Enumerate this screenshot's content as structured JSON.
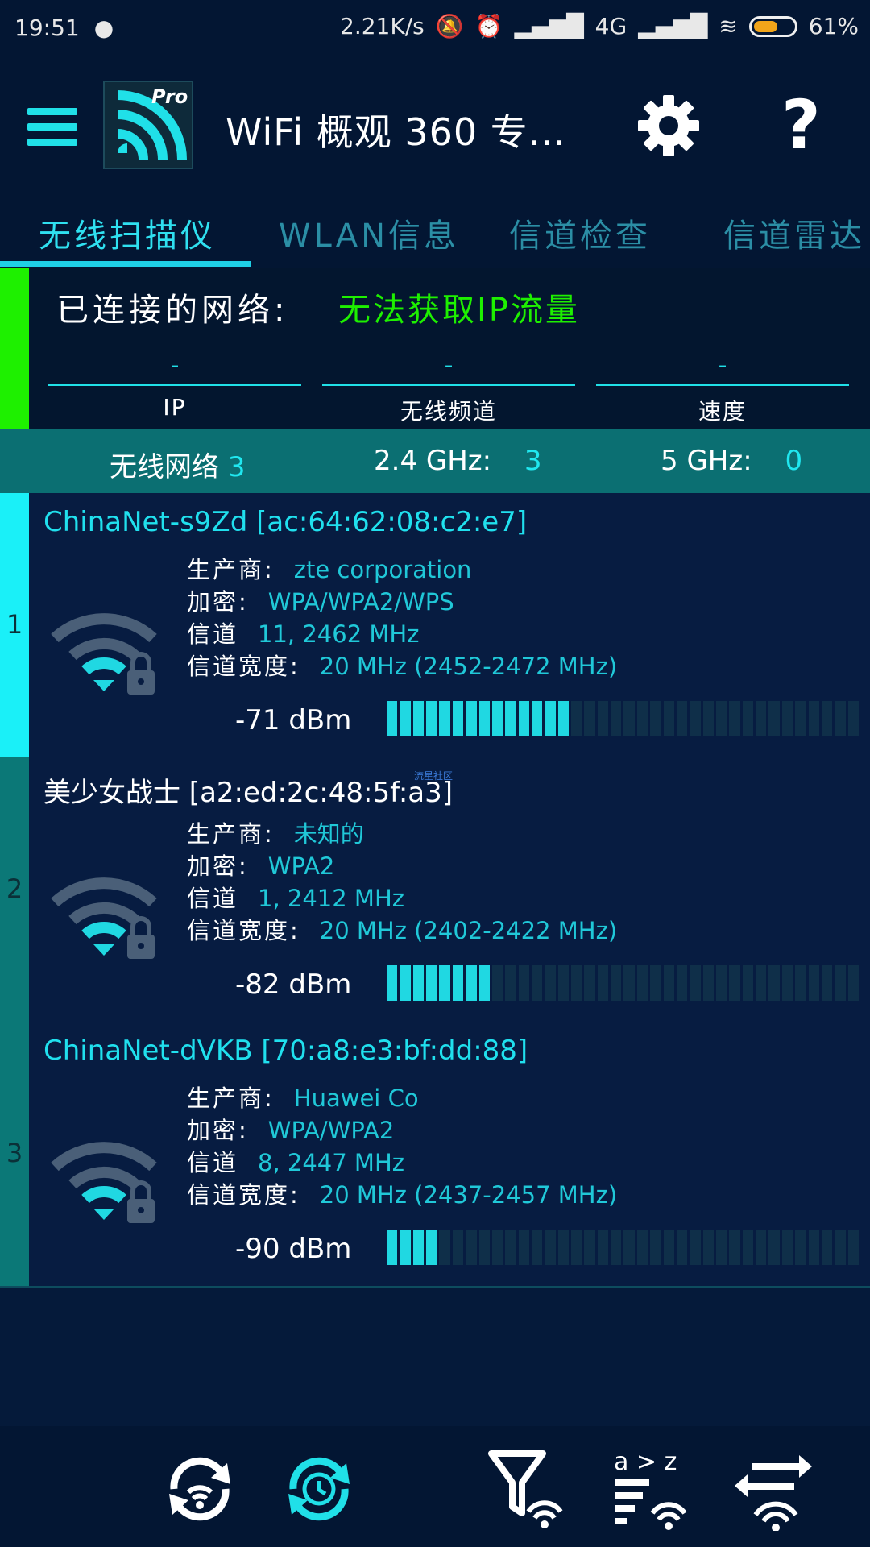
{
  "status_bar": {
    "time": "19:51",
    "speed": "2.21K/s",
    "network": "4G",
    "battery_percent": "61%",
    "battery_level": 0.61,
    "battery_color": "#f2a51a"
  },
  "app_bar": {
    "title": "WiFi 概观 360 专…",
    "logo_badge": "Pro",
    "accent_color": "#20e0e8"
  },
  "tabs": [
    {
      "label": "无线扫描仪",
      "active": true
    },
    {
      "label": "WLAN信息",
      "active": false
    },
    {
      "label": "信道检查",
      "active": false
    },
    {
      "label": "信道雷达",
      "active": false
    }
  ],
  "connected": {
    "label": "已连接的网络:",
    "status": "无法获取IP流量",
    "fields": [
      {
        "value": "-",
        "caption": "IP"
      },
      {
        "value": "-",
        "caption": "无线频道"
      },
      {
        "value": "-",
        "caption": "速度"
      }
    ]
  },
  "summary": {
    "networks_label": "无线网络",
    "networks_count": "3",
    "band24_label": "2.4 GHz:",
    "band24_count": "3",
    "band5_label": "5 GHz:",
    "band5_count": "0"
  },
  "networks": [
    {
      "index": "1",
      "ssid": "ChinaNet-s9Zd [ac:64:62:08:c2:e7]",
      "manufacturer_label": "生产商:",
      "manufacturer": "zte corporation",
      "encryption_label": "加密:",
      "encryption": "WPA/WPA2/WPS",
      "channel_label": "信道",
      "channel": "11, 2462 MHz",
      "width_label": "信道宽度:",
      "width": "20 MHz (2452-2472 MHz)",
      "dbm": "-71 dBm",
      "signal_segments": 14,
      "side_color": "#1af0f8"
    },
    {
      "index": "2",
      "ssid": "美少女战士 [a2:ed:2c:48:5f:a3]",
      "manufacturer_label": "生产商:",
      "manufacturer": "未知的",
      "encryption_label": "加密:",
      "encryption": "WPA2",
      "channel_label": "信道",
      "channel": "1, 2412 MHz",
      "width_label": "信道宽度:",
      "width": "20 MHz (2402-2422 MHz)",
      "dbm": "-82 dBm",
      "signal_segments": 8,
      "side_color": "#0b7877"
    },
    {
      "index": "3",
      "ssid": "ChinaNet-dVKB [70:a8:e3:bf:dd:88]",
      "manufacturer_label": "生产商:",
      "manufacturer": "Huawei Co",
      "encryption_label": "加密:",
      "encryption": "WPA/WPA2",
      "channel_label": "信道",
      "channel": "8, 2447 MHz",
      "width_label": "信道宽度:",
      "width": "20 MHz (2437-2457 MHz)",
      "dbm": "-90 dBm",
      "signal_segments": 4,
      "side_color": "#0b7877"
    }
  ],
  "watermark": "流星社区",
  "bottom_bar": [
    {
      "icon": "wifi-refresh-icon"
    },
    {
      "icon": "timed-refresh-icon"
    },
    {
      "icon": "filter-wifi-icon"
    },
    {
      "icon": "sort-az-icon"
    },
    {
      "icon": "swap-icon"
    }
  ]
}
